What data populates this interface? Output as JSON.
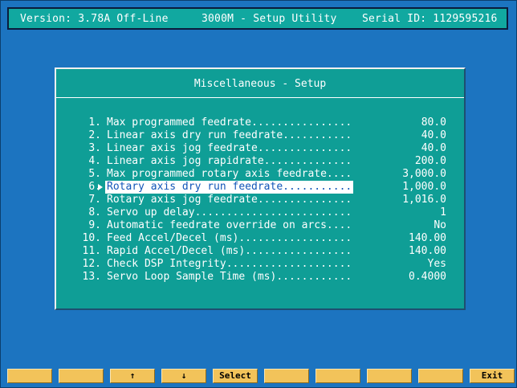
{
  "header": {
    "version": "Version: 3.78A Off-Line",
    "title": "3000M - Setup Utility",
    "serial": "Serial ID: 1129595216"
  },
  "dialog": {
    "title": "Miscellaneous - Setup",
    "selected_index": 5,
    "items": [
      {
        "num": "1.",
        "label": "Max programmed feedrate................",
        "value": "80.0"
      },
      {
        "num": "2.",
        "label": "Linear axis dry run feedrate...........",
        "value": "40.0"
      },
      {
        "num": "3.",
        "label": "Linear axis jog feedrate...............",
        "value": "40.0"
      },
      {
        "num": "4.",
        "label": "Linear axis jog rapidrate..............",
        "value": "200.0"
      },
      {
        "num": "5.",
        "label": "Max programmed rotary axis feedrate....",
        "value": "3,000.0"
      },
      {
        "num": "6.",
        "label": "Rotary axis dry run feedrate...........",
        "value": "1,000.0"
      },
      {
        "num": "7.",
        "label": "Rotary axis jog feedrate...............",
        "value": "1,016.0"
      },
      {
        "num": "8.",
        "label": "Servo up delay.........................",
        "value": "1"
      },
      {
        "num": "9.",
        "label": "Automatic feedrate override on arcs....",
        "value": "No"
      },
      {
        "num": "10.",
        "label": "Feed Accel/Decel (ms)..................",
        "value": "140.00"
      },
      {
        "num": "11.",
        "label": "Rapid Accel/Decel (ms).................",
        "value": "140.00"
      },
      {
        "num": "12.",
        "label": "Check DSP Integrity....................",
        "value": "Yes"
      },
      {
        "num": "13.",
        "label": "Servo Loop Sample Time (ms)............",
        "value": "0.4000"
      }
    ]
  },
  "function_keys": [
    {
      "label": ""
    },
    {
      "label": ""
    },
    {
      "label": "↑"
    },
    {
      "label": "↓"
    },
    {
      "label": "Select"
    },
    {
      "label": ""
    },
    {
      "label": ""
    },
    {
      "label": ""
    },
    {
      "label": ""
    },
    {
      "label": "Exit"
    }
  ],
  "colors": {
    "background": "#1c74c0",
    "panel": "#0f9e96",
    "header": "#11a8a0",
    "fkey": "#f2c35a",
    "selection_text": "#1255b8"
  }
}
